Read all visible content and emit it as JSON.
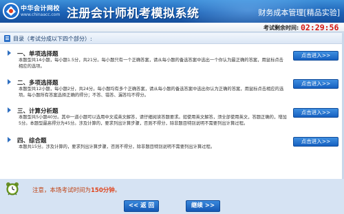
{
  "header": {
    "logo_cn": "中华会计网校",
    "logo_en": "www.chinaacc.com",
    "app_title": "注册会计师机考模拟系统",
    "subject": "财务成本管理[精品实验]"
  },
  "timer": {
    "label": "考试剩余时间:",
    "value": "02:29:56"
  },
  "toc": {
    "title": "目录（考试分成以下四个部分）:"
  },
  "sections": [
    {
      "title": "一、单项选择题",
      "desc": "本题型共14小题，每小题1.5分，共21分。每小题只有一个正确答案，请从每小题的备选答案中选出一个你认为最正确的答案，用鼠标点击相应的选项。",
      "button": "点击进入>>"
    },
    {
      "title": "二、多项选择题",
      "desc": "本题型共12小题，每小题2分，共24分。每小题均有多个正确答案，请从每小题的备选答案中选出你认为正确的答案，用鼠标点击相应的选项。每小题所有答案选择正确的得分；不答、错答、漏答均不得分。",
      "button": "点击进入>>"
    },
    {
      "title": "三、计算分析题",
      "desc": "本题型共5小题40分。其中一道小题可以选用中文或英文解答，请仔细阅读答题要求。如使用英文解答，须全部使用英文，答题正确的，增加5分。本题型最高得分为45分。涉及计算的，要求列出计算步骤，否则不得分，除非题目特别说明不需要列出计算过程。",
      "button": "点击进入>>"
    },
    {
      "title": "四、综合题",
      "desc": "本题共15分。涉及计算的，要求列出计算步骤，否则不得分，除非题目特别说明不需要列出计算过程。",
      "button": "点击进入>>"
    }
  ],
  "notice": {
    "prefix": "注意，本场考试时间为",
    "minutes": "150分钟",
    "suffix": "。"
  },
  "nav": {
    "back": "<< 返 回",
    "continue": "继续 >>"
  },
  "colors": {
    "header_blue": "#1c62b6",
    "timer_red": "#d5160f",
    "notice_orange": "#c04010"
  }
}
